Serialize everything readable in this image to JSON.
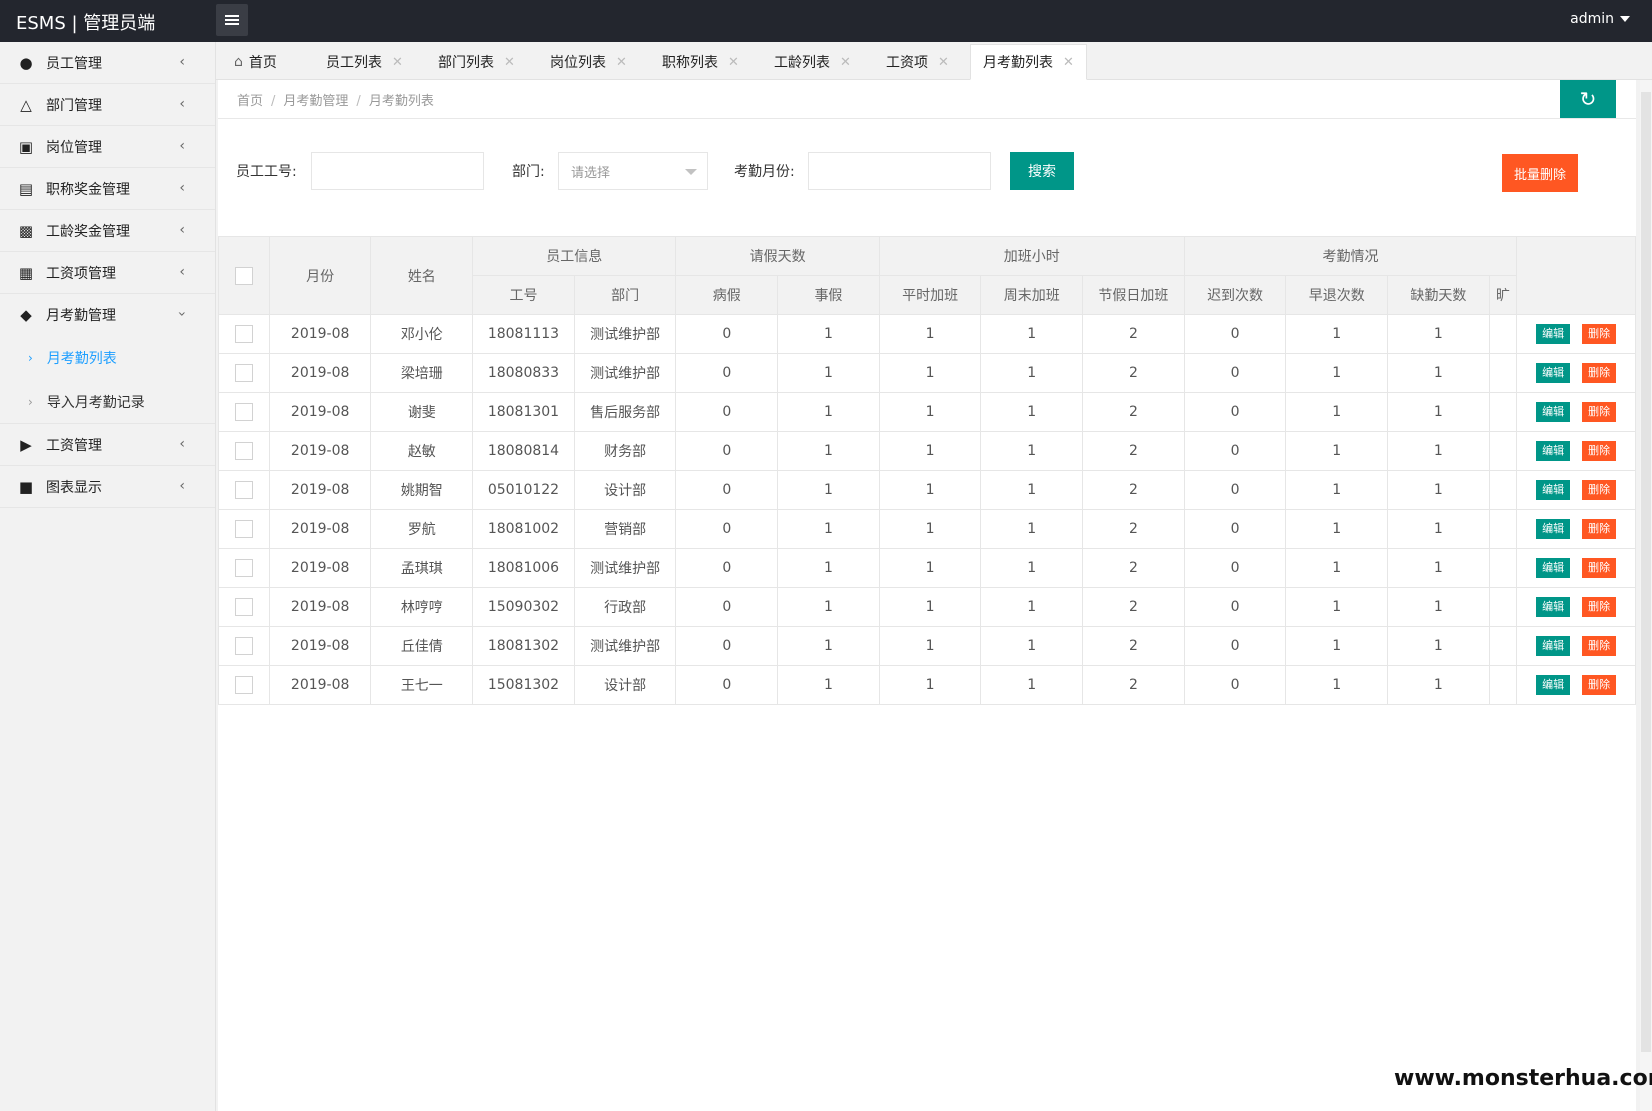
{
  "app": {
    "title": "ESMS | 管理员端",
    "user": "admin"
  },
  "sidebar": {
    "items": [
      {
        "label": "员工管理",
        "icon": "users-icon"
      },
      {
        "label": "部门管理",
        "icon": "sitemap-icon"
      },
      {
        "label": "岗位管理",
        "icon": "badge-icon"
      },
      {
        "label": "职称奖金管理",
        "icon": "briefcase-icon"
      },
      {
        "label": "工龄奖金管理",
        "icon": "cash-register-icon"
      },
      {
        "label": "工资项管理",
        "icon": "money-icon"
      },
      {
        "label": "月考勤管理",
        "icon": "layers-icon"
      },
      {
        "label": "工资管理",
        "icon": "tag-icon"
      },
      {
        "label": "图表显示",
        "icon": "receipt-icon"
      }
    ],
    "sub_items": [
      {
        "label": "月考勤列表"
      },
      {
        "label": "导入月考勤记录"
      }
    ]
  },
  "tabs": [
    {
      "label": "首页"
    },
    {
      "label": "员工列表"
    },
    {
      "label": "部门列表"
    },
    {
      "label": "岗位列表"
    },
    {
      "label": "职称列表"
    },
    {
      "label": "工龄列表"
    },
    {
      "label": "工资项"
    },
    {
      "label": "月考勤列表"
    }
  ],
  "breadcrumb": [
    "首页",
    "月考勤管理",
    "月考勤列表"
  ],
  "search": {
    "emp_no_label": "员工工号:",
    "dept_label": "部门:",
    "dept_placeholder": "请选择",
    "month_label": "考勤月份:",
    "search_button": "搜索",
    "batch_delete_button": "批量删除"
  },
  "table": {
    "headers": {
      "month": "月份",
      "name": "姓名",
      "group_emp": "员工信息",
      "group_leave": "请假天数",
      "group_overtime": "加班小时",
      "group_attendance": "考勤情况",
      "emp_no": "工号",
      "dept": "部门",
      "sick": "病假",
      "personal": "事假",
      "weekday_ot": "平时加班",
      "weekend_ot": "周末加班",
      "holiday_ot": "节假日加班",
      "late": "迟到次数",
      "early": "早退次数",
      "absent": "缺勤天数",
      "cut": "旷"
    },
    "edit_label": "编辑",
    "delete_label": "删除",
    "rows": [
      {
        "month": "2019-08",
        "name": "邓小伦",
        "emp_no": "18081113",
        "dept": "测试维护部",
        "sick": "0",
        "personal": "1",
        "weekday_ot": "1",
        "weekend_ot": "1",
        "holiday_ot": "2",
        "late": "0",
        "early": "1",
        "absent": "1"
      },
      {
        "month": "2019-08",
        "name": "梁培珊",
        "emp_no": "18080833",
        "dept": "测试维护部",
        "sick": "0",
        "personal": "1",
        "weekday_ot": "1",
        "weekend_ot": "1",
        "holiday_ot": "2",
        "late": "0",
        "early": "1",
        "absent": "1"
      },
      {
        "month": "2019-08",
        "name": "谢斐",
        "emp_no": "18081301",
        "dept": "售后服务部",
        "sick": "0",
        "personal": "1",
        "weekday_ot": "1",
        "weekend_ot": "1",
        "holiday_ot": "2",
        "late": "0",
        "early": "1",
        "absent": "1"
      },
      {
        "month": "2019-08",
        "name": "赵敏",
        "emp_no": "18080814",
        "dept": "财务部",
        "sick": "0",
        "personal": "1",
        "weekday_ot": "1",
        "weekend_ot": "1",
        "holiday_ot": "2",
        "late": "0",
        "early": "1",
        "absent": "1"
      },
      {
        "month": "2019-08",
        "name": "姚期智",
        "emp_no": "05010122",
        "dept": "设计部",
        "sick": "0",
        "personal": "1",
        "weekday_ot": "1",
        "weekend_ot": "1",
        "holiday_ot": "2",
        "late": "0",
        "early": "1",
        "absent": "1"
      },
      {
        "month": "2019-08",
        "name": "罗航",
        "emp_no": "18081002",
        "dept": "营销部",
        "sick": "0",
        "personal": "1",
        "weekday_ot": "1",
        "weekend_ot": "1",
        "holiday_ot": "2",
        "late": "0",
        "early": "1",
        "absent": "1"
      },
      {
        "month": "2019-08",
        "name": "孟琪琪",
        "emp_no": "18081006",
        "dept": "测试维护部",
        "sick": "0",
        "personal": "1",
        "weekday_ot": "1",
        "weekend_ot": "1",
        "holiday_ot": "2",
        "late": "0",
        "early": "1",
        "absent": "1"
      },
      {
        "month": "2019-08",
        "name": "林哼哼",
        "emp_no": "15090302",
        "dept": "行政部",
        "sick": "0",
        "personal": "1",
        "weekday_ot": "1",
        "weekend_ot": "1",
        "holiday_ot": "2",
        "late": "0",
        "early": "1",
        "absent": "1"
      },
      {
        "month": "2019-08",
        "name": "丘佳倩",
        "emp_no": "18081302",
        "dept": "测试维护部",
        "sick": "0",
        "personal": "1",
        "weekday_ot": "1",
        "weekend_ot": "1",
        "holiday_ot": "2",
        "late": "0",
        "early": "1",
        "absent": "1"
      },
      {
        "month": "2019-08",
        "name": "王七一",
        "emp_no": "15081302",
        "dept": "设计部",
        "sick": "0",
        "personal": "1",
        "weekday_ot": "1",
        "weekend_ot": "1",
        "holiday_ot": "2",
        "late": "0",
        "early": "1",
        "absent": "1"
      }
    ]
  },
  "watermark": "www.monsterhua.com"
}
